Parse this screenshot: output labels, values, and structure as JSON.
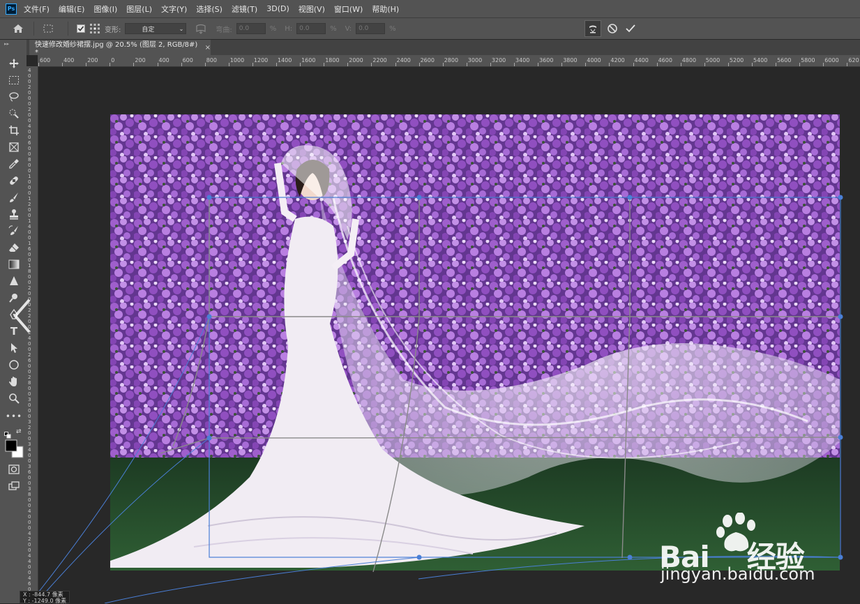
{
  "menu": [
    "文件(F)",
    "编辑(E)",
    "图像(I)",
    "图层(L)",
    "文字(Y)",
    "选择(S)",
    "滤镜(T)",
    "3D(D)",
    "视图(V)",
    "窗口(W)",
    "帮助(H)"
  ],
  "app_logo": "Ps",
  "options": {
    "warp_label": "变形:",
    "warp_value": "自定",
    "bend_label": "弯曲:",
    "bend_value": "0.0",
    "h_label": "H:",
    "h_value": "0.0",
    "v_label": "V:",
    "v_value": "0.0",
    "percent": "%",
    "cancel_icon": "cancel-icon",
    "commit_icon": "commit-checkmark-icon"
  },
  "document_tab": {
    "title": "快速修改婚纱裙摆.jpg @ 20.5% (图层 2, RGB/8#) *",
    "close": "×"
  },
  "ruler_h_labels": [
    "600",
    "400",
    "200",
    "0",
    "200",
    "400",
    "600",
    "800",
    "1000",
    "1200",
    "1400",
    "1600",
    "1800",
    "2000",
    "2200",
    "2400",
    "2600",
    "2800",
    "3000",
    "3200",
    "3400",
    "3600",
    "3800",
    "4000",
    "4200",
    "4400",
    "4600",
    "4800",
    "5000",
    "5200",
    "5400",
    "5600",
    "5800",
    "6000",
    "620"
  ],
  "coord_readout": {
    "x": "X : -844.7 像素",
    "y": "Y : -1249.0 像素"
  },
  "watermark": {
    "brand": "Bai",
    "brand_suffix": "经验",
    "url": "jingyan.baidu.com"
  },
  "colors": {
    "accent": "#31a8ff",
    "warp_grid": "#4a7fd6",
    "panel": "#535353",
    "canvas": "#282828"
  },
  "tools": [
    "move-icon",
    "marquee-icon",
    "lasso-icon",
    "quick-select-icon",
    "crop-icon",
    "frame-icon",
    "eyedropper-icon",
    "healing-icon",
    "brush-icon",
    "stamp-icon",
    "history-brush-icon",
    "eraser-icon",
    "gradient-icon",
    "blur-icon",
    "dodge-icon",
    "pen-icon",
    "type-icon",
    "path-select-icon",
    "ellipse-icon",
    "hand-icon",
    "zoom-icon",
    "more-icon"
  ]
}
